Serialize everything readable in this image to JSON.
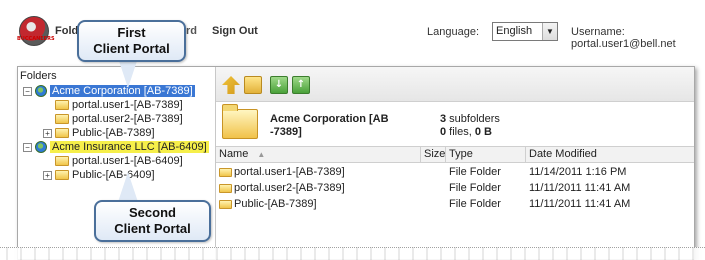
{
  "app": {
    "logo_text": "BUCCANEERS"
  },
  "nav": {
    "folders": "Folders",
    "dashboard_fragment": "rd",
    "signout": "Sign Out"
  },
  "language": {
    "label": "Language:",
    "selected": "English"
  },
  "user": {
    "label": "Username: portal.user1@bell.net"
  },
  "folders_pane": {
    "title": "Folders",
    "tree": [
      {
        "label": "Acme Corporation [AB-7389]",
        "toggle": "⊟",
        "kind": "globe",
        "selected": "blue"
      },
      {
        "label": "portal.user1-[AB-7389]",
        "kind": "folder"
      },
      {
        "label": "portal.user2-[AB-7389]",
        "kind": "folder"
      },
      {
        "label": "Public-[AB-7389]",
        "toggle": "⊞",
        "kind": "folder"
      },
      {
        "label": "Acme Insurance LLC [AB-6409]",
        "toggle": "⊟",
        "kind": "globe",
        "selected": "yellow"
      },
      {
        "label": "portal.user1-[AB-6409]",
        "kind": "folder"
      },
      {
        "label": "Public-[AB-6409]",
        "toggle": "⊞",
        "kind": "folder"
      }
    ]
  },
  "toolbar": {
    "icons": [
      "folder-up-icon",
      "new-folder-icon",
      "download-icon",
      "upload-icon"
    ]
  },
  "current_folder": {
    "name": "Acme Corporation [AB -7389]",
    "subfolders_count": "3",
    "subfolders_label": " subfolders",
    "files_count": "0",
    "files_label": " files, ",
    "size": "0 B"
  },
  "grid": {
    "headers": {
      "name": "Name",
      "sort_icon": "▲",
      "size": "Size",
      "type": "Type",
      "date": "Date Modified"
    },
    "rows": [
      {
        "name": "portal.user1-[AB-7389]",
        "size": "",
        "type": "File Folder",
        "date": "11/14/2011 1:16 PM"
      },
      {
        "name": "portal.user2-[AB-7389]",
        "size": "",
        "type": "File Folder",
        "date": "11/11/2011 11:41 AM"
      },
      {
        "name": "Public-[AB-7389]",
        "size": "",
        "type": "File Folder",
        "date": "11/11/2011 11:41 AM"
      }
    ]
  },
  "callouts": {
    "first_line1": "First",
    "first_line2": "Client Portal",
    "second_line1": "Second",
    "second_line2": "Client Portal"
  }
}
